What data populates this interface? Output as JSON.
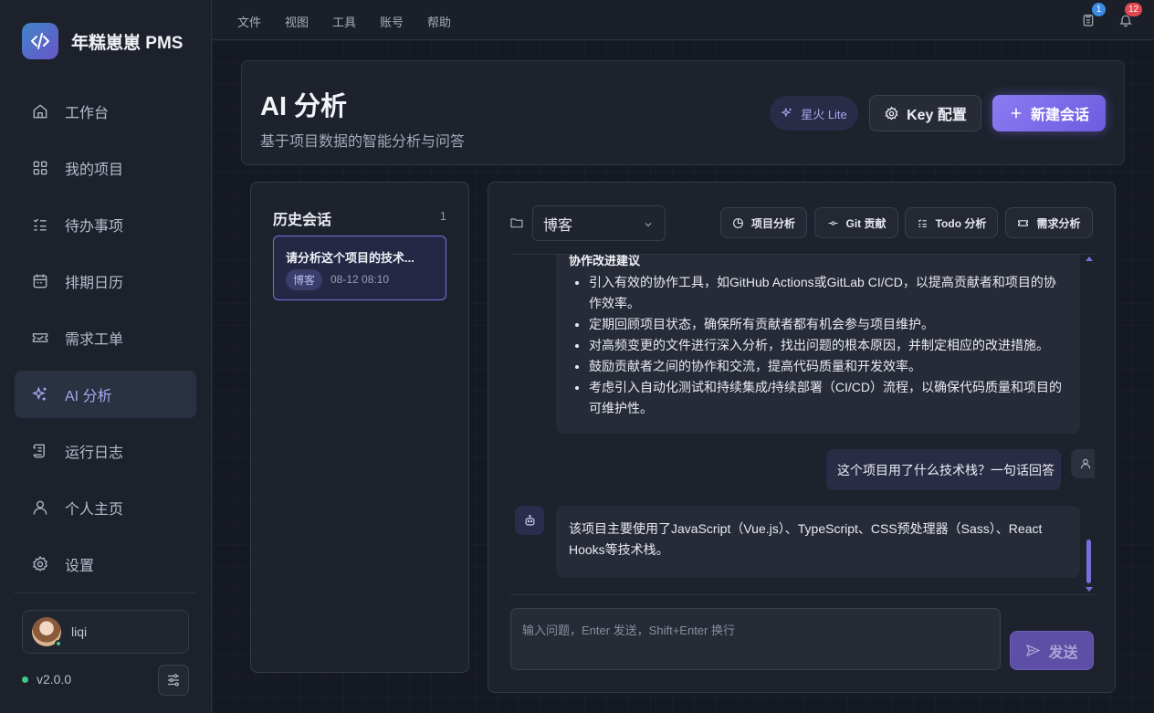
{
  "app": {
    "name": "年糕崽崽 PMS",
    "version": "v2.0.0"
  },
  "menubar": {
    "items": [
      "文件",
      "视图",
      "工具",
      "账号",
      "帮助"
    ],
    "clipboard_badge": "1",
    "notification_badge": "12"
  },
  "sidebar": {
    "items": [
      {
        "label": "工作台",
        "icon": "home-icon"
      },
      {
        "label": "我的项目",
        "icon": "grid-icon"
      },
      {
        "label": "待办事项",
        "icon": "checklist-icon"
      },
      {
        "label": "排期日历",
        "icon": "calendar-icon"
      },
      {
        "label": "需求工单",
        "icon": "ticket-icon"
      },
      {
        "label": "AI 分析",
        "icon": "sparkles-icon",
        "active": true
      },
      {
        "label": "运行日志",
        "icon": "scroll-icon"
      },
      {
        "label": "个人主页",
        "icon": "user-icon"
      },
      {
        "label": "设置",
        "icon": "gear-icon"
      }
    ],
    "user": {
      "name": "liqi"
    }
  },
  "header": {
    "title": "AI 分析",
    "subtitle": "基于项目数据的智能分析与问答",
    "model_label": "星火 Lite",
    "key_button": "Key 配置",
    "new_button": "新建会话"
  },
  "history": {
    "title": "历史会话",
    "count": "1",
    "items": [
      {
        "title": "请分析这个项目的技术...",
        "tag": "博客",
        "time": "08-12 08:10"
      }
    ]
  },
  "chat": {
    "project_select": "博客",
    "quick_actions": [
      "项目分析",
      "Git 贡献",
      "Todo 分析",
      "需求分析"
    ],
    "messages": {
      "bot_heading_partial": "协作改进建议",
      "bot_bullets": [
        "引入有效的协作工具，如GitHub Actions或GitLab CI/CD，以提高贡献者和项目的协作效率。",
        "定期回顾项目状态，确保所有贡献者都有机会参与项目维护。",
        "对高频变更的文件进行深入分析，找出问题的根本原因，并制定相应的改进措施。",
        "鼓励贡献者之间的协作和交流，提高代码质量和开发效率。",
        "考虑引入自动化测试和持续集成/持续部署（CI/CD）流程，以确保代码质量和项目的可维护性。"
      ],
      "user_question": "这个项目用了什么技术栈？一句话回答",
      "bot_answer": "该项目主要使用了JavaScript（Vue.js）、TypeScript、CSS预处理器（Sass）、React Hooks等技术栈。"
    },
    "input_placeholder": "输入问题，Enter 发送，Shift+Enter 换行",
    "send_button": "发送"
  },
  "colors": {
    "accent": "#7c6ee0",
    "online": "#3ec78a",
    "badge_blue": "#3d8be8",
    "badge_red": "#e2474f"
  }
}
